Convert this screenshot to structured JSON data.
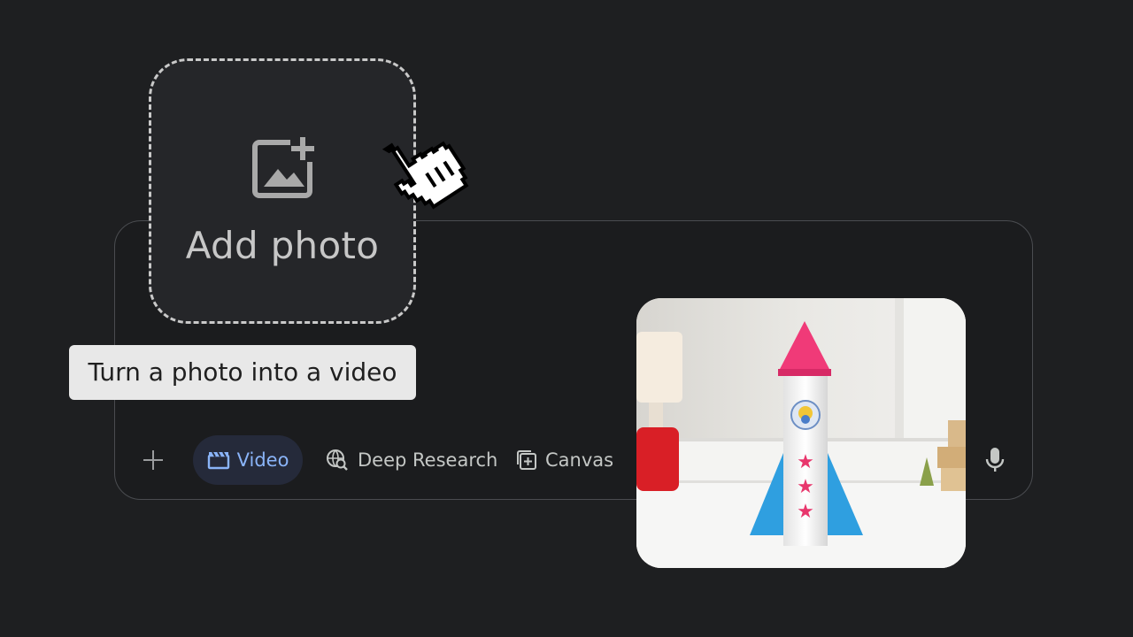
{
  "dropzone": {
    "label": "Add photo",
    "icon": "add-photo-icon"
  },
  "tooltip": {
    "text": "Turn a photo into a video"
  },
  "toolbar": {
    "plus_icon": "plus-icon",
    "video_label": "Video",
    "video_icon": "clapperboard-icon",
    "deep_research_label": "Deep Research",
    "deep_research_icon": "globe-search-icon",
    "canvas_label": "Canvas",
    "canvas_icon": "canvas-add-icon",
    "mic_icon": "microphone-icon"
  },
  "preview": {
    "subject": "photo-preview"
  },
  "colors": {
    "background": "#1e1f21",
    "accent": "#8ab4f8",
    "chip_active_bg": "#252a3a",
    "text_muted": "#c4c7c5"
  }
}
